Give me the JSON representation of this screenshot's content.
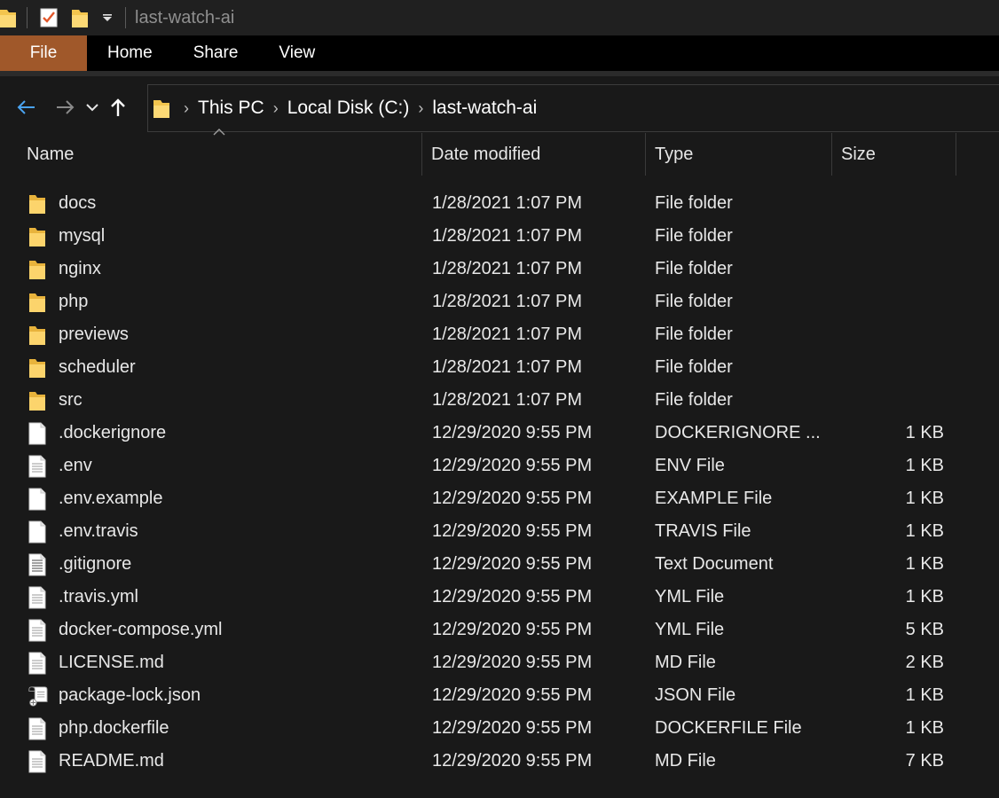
{
  "window": {
    "title": "last-watch-ai"
  },
  "quick_access": {
    "icons": [
      "folder-icon",
      "properties-checkmark-icon",
      "new-folder-icon",
      "customize-dropdown-icon"
    ]
  },
  "ribbon": {
    "tabs": [
      {
        "id": "file",
        "label": "File",
        "active": true
      },
      {
        "id": "home",
        "label": "Home"
      },
      {
        "id": "share",
        "label": "Share"
      },
      {
        "id": "view",
        "label": "View"
      }
    ],
    "file_tab_color": "#a0582a"
  },
  "navigation": {
    "breadcrumbs": [
      "This PC",
      "Local Disk (C:)",
      "last-watch-ai"
    ]
  },
  "columns": {
    "name": "Name",
    "date": "Date modified",
    "type": "Type",
    "size": "Size"
  },
  "files": [
    {
      "name": "docs",
      "date": "1/28/2021 1:07 PM",
      "type": "File folder",
      "size": "",
      "icon": "folder"
    },
    {
      "name": "mysql",
      "date": "1/28/2021 1:07 PM",
      "type": "File folder",
      "size": "",
      "icon": "folder"
    },
    {
      "name": "nginx",
      "date": "1/28/2021 1:07 PM",
      "type": "File folder",
      "size": "",
      "icon": "folder"
    },
    {
      "name": "php",
      "date": "1/28/2021 1:07 PM",
      "type": "File folder",
      "size": "",
      "icon": "folder"
    },
    {
      "name": "previews",
      "date": "1/28/2021 1:07 PM",
      "type": "File folder",
      "size": "",
      "icon": "folder"
    },
    {
      "name": "scheduler",
      "date": "1/28/2021 1:07 PM",
      "type": "File folder",
      "size": "",
      "icon": "folder"
    },
    {
      "name": "src",
      "date": "1/28/2021 1:07 PM",
      "type": "File folder",
      "size": "",
      "icon": "folder"
    },
    {
      "name": ".dockerignore",
      "date": "12/29/2020 9:55 PM",
      "type": "DOCKERIGNORE ...",
      "size": "1 KB",
      "icon": "blank"
    },
    {
      "name": ".env",
      "date": "12/29/2020 9:55 PM",
      "type": "ENV File",
      "size": "1 KB",
      "icon": "text"
    },
    {
      "name": ".env.example",
      "date": "12/29/2020 9:55 PM",
      "type": "EXAMPLE File",
      "size": "1 KB",
      "icon": "blank"
    },
    {
      "name": ".env.travis",
      "date": "12/29/2020 9:55 PM",
      "type": "TRAVIS File",
      "size": "1 KB",
      "icon": "blank"
    },
    {
      "name": ".gitignore",
      "date": "12/29/2020 9:55 PM",
      "type": "Text Document",
      "size": "1 KB",
      "icon": "lined"
    },
    {
      "name": ".travis.yml",
      "date": "12/29/2020 9:55 PM",
      "type": "YML File",
      "size": "1 KB",
      "icon": "text"
    },
    {
      "name": "docker-compose.yml",
      "date": "12/29/2020 9:55 PM",
      "type": "YML File",
      "size": "5 KB",
      "icon": "text"
    },
    {
      "name": "LICENSE.md",
      "date": "12/29/2020 9:55 PM",
      "type": "MD File",
      "size": "2 KB",
      "icon": "text"
    },
    {
      "name": "package-lock.json",
      "date": "12/29/2020 9:55 PM",
      "type": "JSON File",
      "size": "1 KB",
      "icon": "script"
    },
    {
      "name": "php.dockerfile",
      "date": "12/29/2020 9:55 PM",
      "type": "DOCKERFILE File",
      "size": "1 KB",
      "icon": "text"
    },
    {
      "name": "README.md",
      "date": "12/29/2020 9:55 PM",
      "type": "MD File",
      "size": "7 KB",
      "icon": "text"
    }
  ]
}
